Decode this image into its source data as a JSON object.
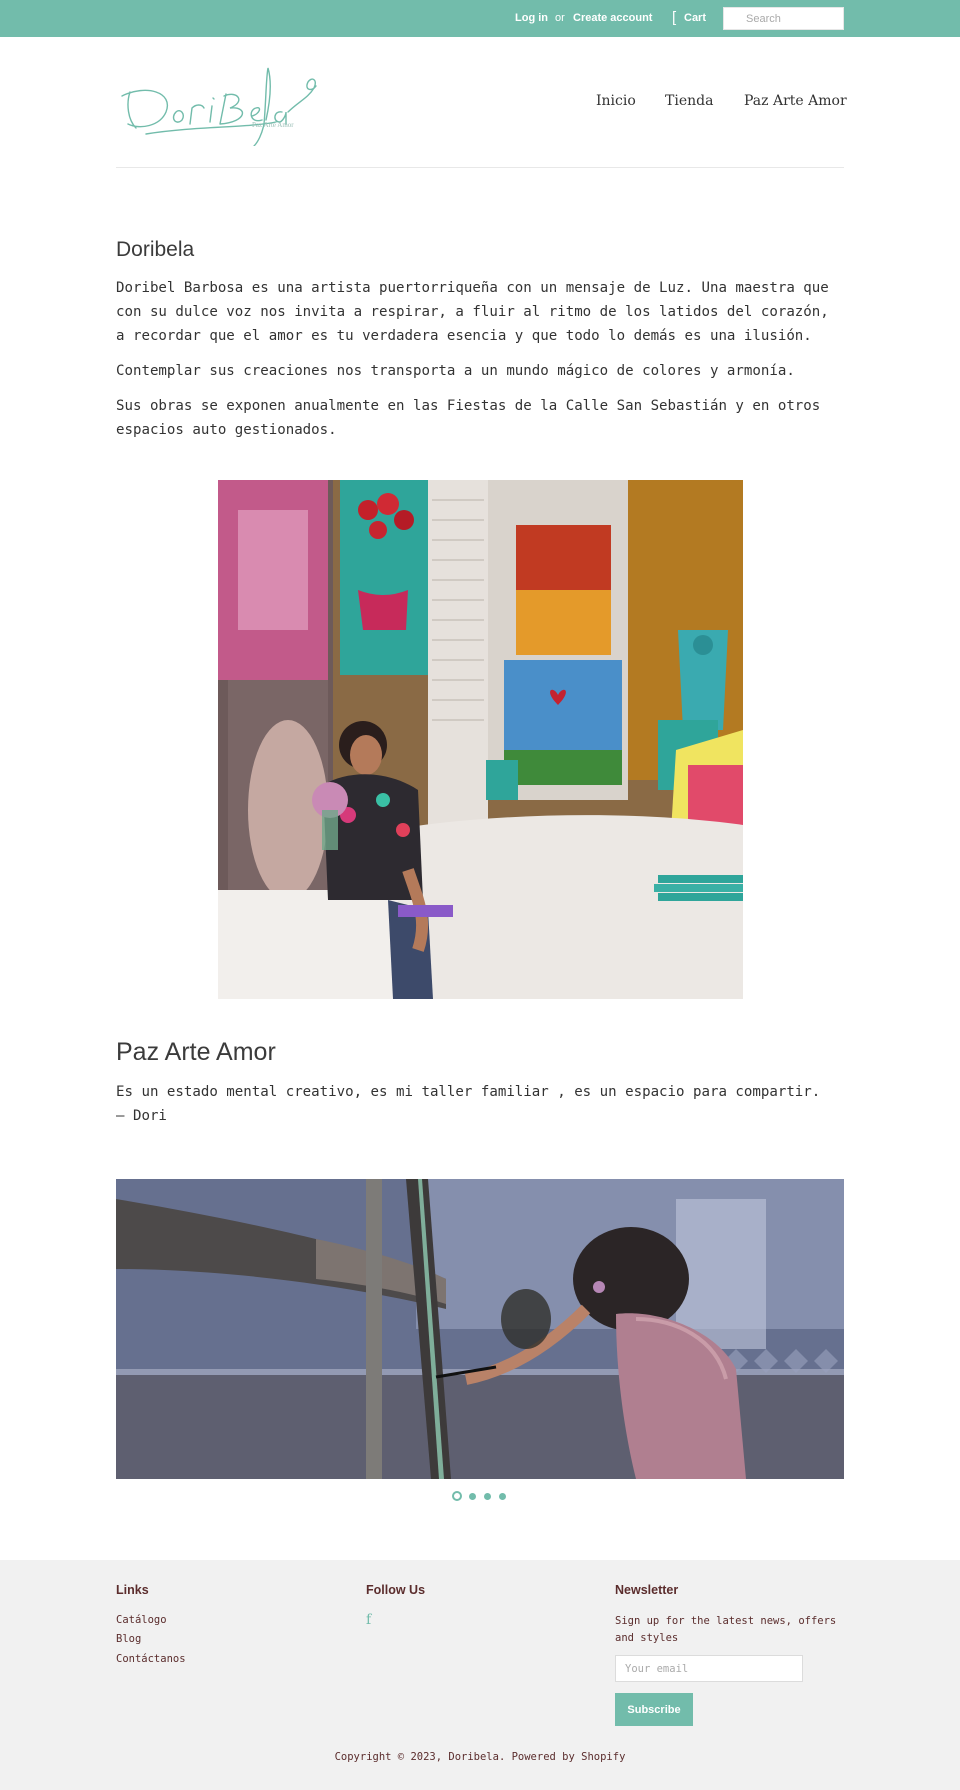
{
  "topbar": {
    "login": "Log in",
    "or": "or",
    "create_account": "Create account",
    "cart_icon": "[",
    "cart": "Cart",
    "search_icon": "s",
    "search_placeholder": "Search"
  },
  "header": {
    "logo_text": "Doribela",
    "logo_tagline": "Paz Arte Amor",
    "nav": [
      "Inicio",
      "Tienda",
      "Paz Arte Amor"
    ]
  },
  "main": {
    "section1_title": "Doribela",
    "section1_paragraphs": [
      "Doribel Barbosa es una artista puertorriqueña con un mensaje de Luz. Una maestra que con su dulce voz nos invita a respirar, a fluir al ritmo de los latidos del corazón, a recordar que el amor es tu verdadera esencia y que todo lo demás es una ilusión.",
      "Contemplar sus creaciones nos transporta a un mundo mágico de colores y armonía.",
      "Sus obras se exponen anualmente en las Fiestas de la Calle San Sebastián y en otros espacios auto gestionados."
    ],
    "section2_title": "Paz Arte Amor",
    "section2_paragraph": "Es un estado mental creativo, es mi taller familiar , es un espacio para compartir. — Dori",
    "slideshow": {
      "slides": 4,
      "active_slide": 1
    }
  },
  "footer": {
    "links_heading": "Links",
    "links": [
      "Catálogo",
      "Blog",
      "Contáctanos"
    ],
    "follow_heading": "Follow Us",
    "facebook_icon": "f",
    "newsletter_heading": "Newsletter",
    "newsletter_text": "Sign up for the latest news, offers and styles",
    "email_placeholder": "Your email",
    "subscribe_label": "Subscribe",
    "copyright": "Copyright © 2023, Doribela. Powered by Shopify"
  },
  "colors": {
    "accent": "#72bcab",
    "footer_text": "#5b2d2d",
    "footer_bg": "#f1f1f1"
  }
}
